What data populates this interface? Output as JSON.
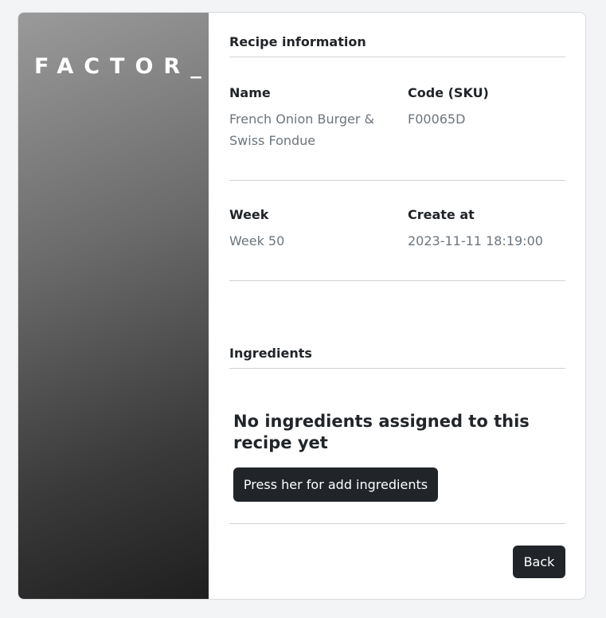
{
  "brand": {
    "logo_text": "FACTOR_"
  },
  "recipe_info": {
    "section_title": "Recipe information",
    "name_label": "Name",
    "name_value": "French Onion Burger & Swiss Fondue",
    "code_label": "Code (SKU)",
    "code_value": "F00065D",
    "week_label": "Week",
    "week_value": "Week 50",
    "created_label": "Create at",
    "created_value": "2023-11-11 18:19:00"
  },
  "ingredients": {
    "section_title": "Ingredients",
    "empty_message": "No ingredients assigned to this recipe yet",
    "add_button_label": "Press her for add ingredients"
  },
  "footer": {
    "back_button_label": "Back"
  },
  "colors": {
    "button_bg": "#212529",
    "muted_text": "#6c757d",
    "page_bg": "#f3f4f6"
  }
}
